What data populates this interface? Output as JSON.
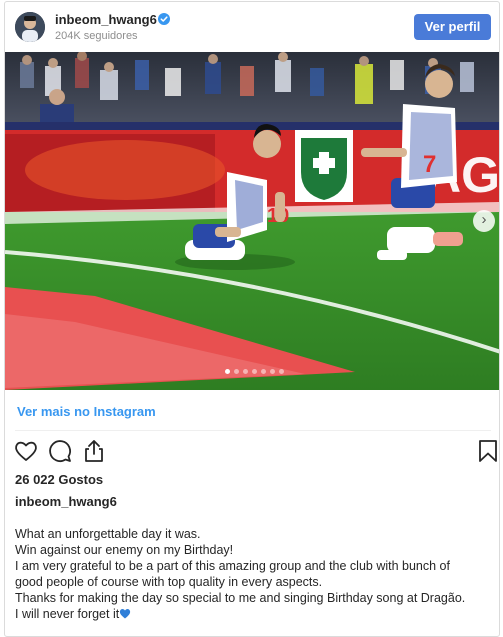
{
  "header": {
    "username": "inbeom_hwang6",
    "followers": "204K seguidores",
    "view_profile_label": "Ver perfil"
  },
  "photo": {
    "carousel_count": 7,
    "carousel_active": 0
  },
  "view_more_label": "Ver mais no Instagram",
  "likes_text": "26 022 Gostos",
  "caption": {
    "username": "inbeom_hwang6",
    "lines": [
      "What an unforgettable day it was.",
      "Win against our enemy on my Birthday!",
      "I am very grateful to be a part of this amazing group and the club with bunch of",
      "good people of course with top quality in every aspects.",
      "Thanks for making the day so special to me and singing Birthday song at Dragão.",
      "I will never forget it"
    ]
  },
  "colors": {
    "accent": "#4a7bd8",
    "link": "#3897f0",
    "verified": "#3897f0"
  },
  "icons": [
    "verified-badge-icon",
    "heart-icon",
    "comment-icon",
    "share-icon",
    "bookmark-icon",
    "chevron-right-icon",
    "blue-heart-emoji"
  ]
}
